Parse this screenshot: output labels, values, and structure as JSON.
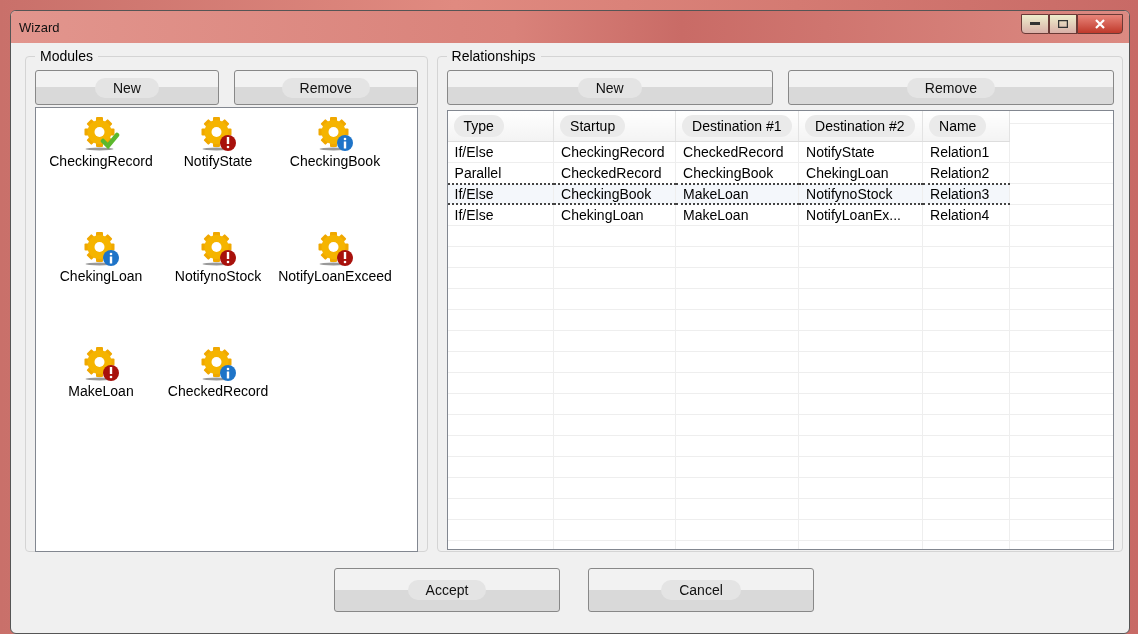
{
  "window": {
    "title": "Wizard"
  },
  "modules": {
    "title": "Modules",
    "buttons": [
      "New",
      "Remove"
    ],
    "items": [
      {
        "label": "CheckingRecord",
        "kind": "check"
      },
      {
        "label": "NotifyState",
        "kind": "error"
      },
      {
        "label": "CheckingBook",
        "kind": "info"
      },
      {
        "label": "ChekingLoan",
        "kind": "info"
      },
      {
        "label": "NotifynoStock",
        "kind": "error"
      },
      {
        "label": "NotifyLoanExceed",
        "kind": "error"
      },
      {
        "label": "MakeLoan",
        "kind": "error"
      },
      {
        "label": "CheckedRecord",
        "kind": "info"
      }
    ]
  },
  "relationships": {
    "title": "Relationships",
    "buttons": [
      "New",
      "Remove"
    ],
    "table": {
      "columns": [
        "Type",
        "Startup",
        "Destination #1",
        "Destination #2",
        "Name"
      ],
      "rows": [
        {
          "cells": [
            "If/Else",
            "CheckingRecord",
            "CheckedRecord",
            "NotifyState",
            "Relation1"
          ],
          "selected": false
        },
        {
          "cells": [
            "Parallel",
            "CheckedRecord",
            "CheckingBook",
            "ChekingLoan",
            "Relation2"
          ],
          "selected": false
        },
        {
          "cells": [
            "If/Else",
            "CheckingBook",
            "MakeLoan",
            "NotifynoStock",
            "Relation3"
          ],
          "selected": true
        },
        {
          "cells": [
            "If/Else",
            "ChekingLoan",
            "MakeLoan",
            "NotifyLoanEx...",
            "Relation4"
          ],
          "selected": false
        }
      ]
    }
  },
  "buttons": [
    "Accept",
    "Cancel"
  ]
}
